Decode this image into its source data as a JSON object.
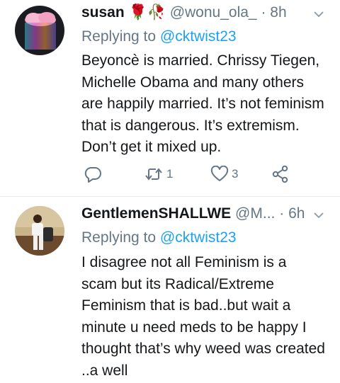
{
  "tweets": [
    {
      "name": "susan",
      "emoji": "🌹🥀",
      "handle": "@wonu_ola_",
      "time": "8h",
      "replying_prefix": "Replying to",
      "replying_to": "@cktwist23",
      "text": "Beyoncè is married. Chrissy Tiegen, Michelle Obama and many others are happily married. It’s not feminism that is dangerous. It’s extremism. Don’t get it mixed up.",
      "retweets": "1",
      "likes": "3"
    },
    {
      "name": "GentlemenSHALLWE",
      "handle": "@M...",
      "time": "6h",
      "replying_prefix": "Replying to",
      "replying_to": "@cktwist23",
      "text": "I disagree not all Feminism is a scam but its Radical/Extreme Feminism that is bad..but wait a minute u need meds to be happy I thought that’s why weed was created ..a well"
    }
  ],
  "colors": {
    "accent": "#1da1f2",
    "secondary_text": "#657786",
    "divider": "#e6ecf0"
  },
  "icons": [
    "reply-icon",
    "retweet-icon",
    "like-icon",
    "share-icon",
    "chevron-down-icon"
  ]
}
